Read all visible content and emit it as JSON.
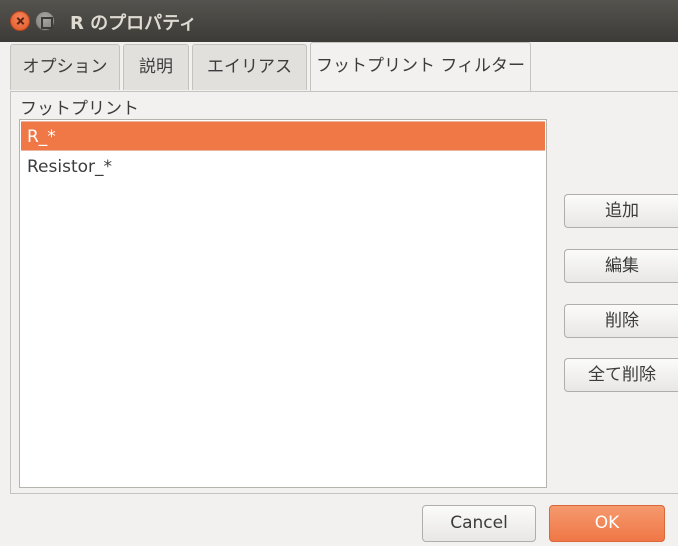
{
  "window": {
    "title": "R のプロパティ"
  },
  "tabs": [
    {
      "label": "オプション"
    },
    {
      "label": "説明"
    },
    {
      "label": "エイリアス"
    },
    {
      "label": "フットプリント フィルター",
      "active": true
    }
  ],
  "footprints": {
    "label": "フットプリント",
    "items": [
      "R_*",
      "Resistor_*"
    ],
    "selected_index": 0
  },
  "side_buttons": {
    "add": "追加",
    "edit": "編集",
    "delete": "削除",
    "delete_all": "全て削除"
  },
  "footer": {
    "cancel": "Cancel",
    "ok": "OK"
  },
  "colors": {
    "accent": "#f07746",
    "titlebar": "#3c3b37"
  }
}
